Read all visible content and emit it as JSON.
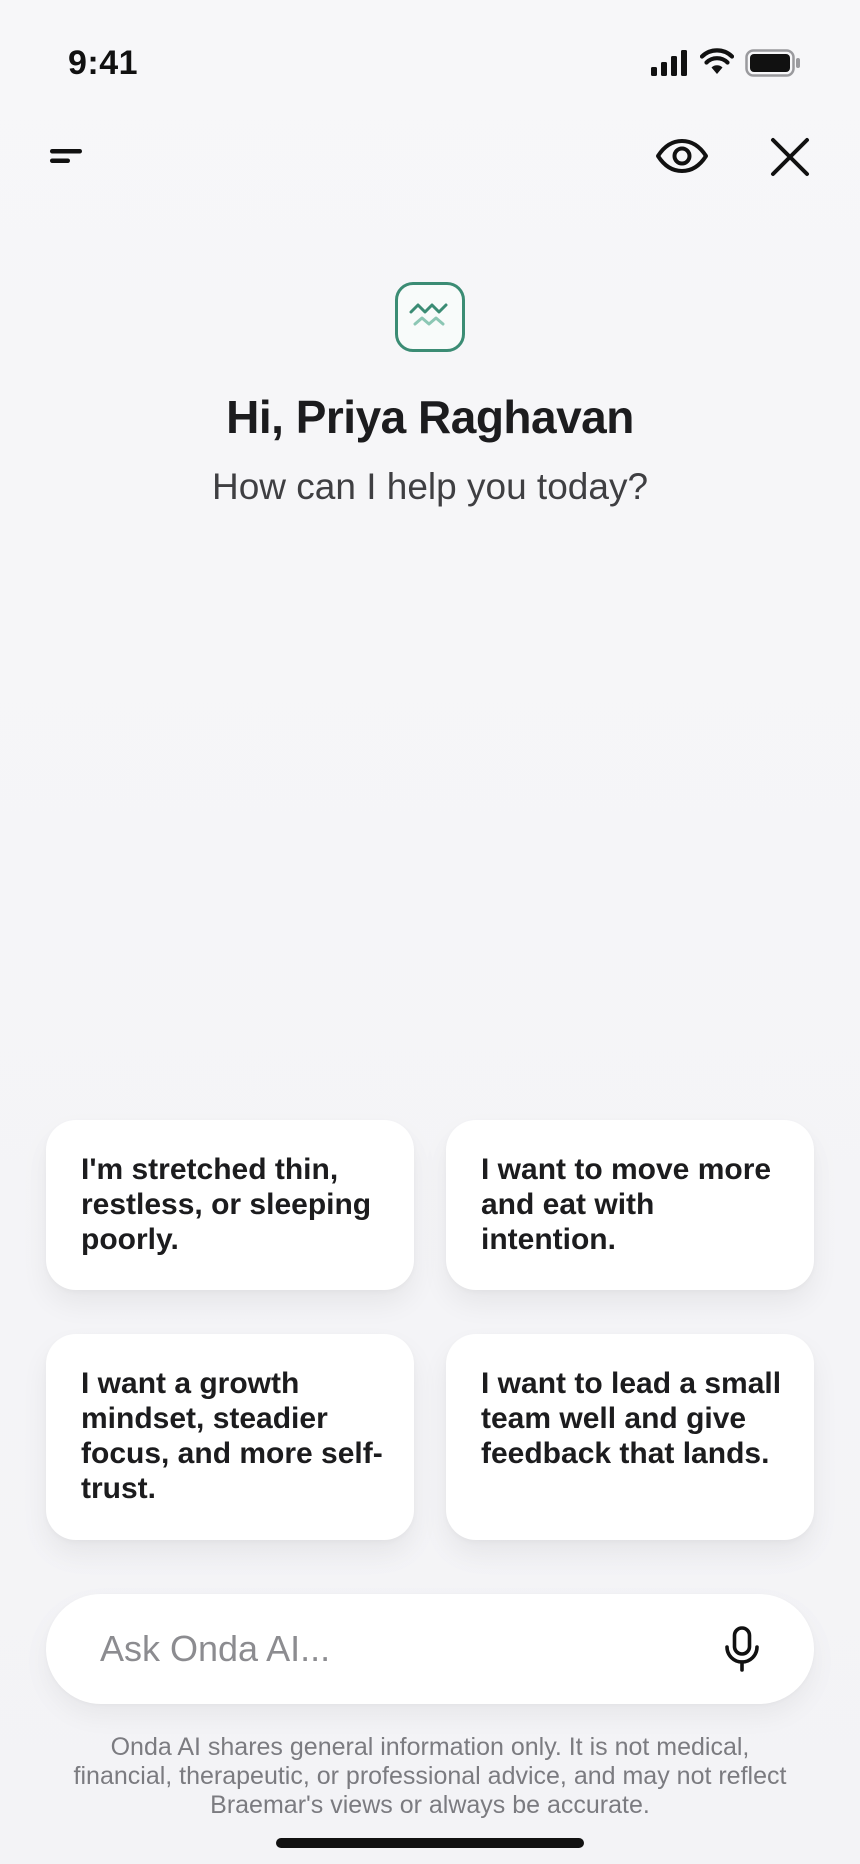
{
  "status_bar": {
    "time": "9:41",
    "icons": [
      "cellular-signal-icon",
      "wifi-icon",
      "battery-icon"
    ]
  },
  "nav": {
    "menu_icon": "menu-icon",
    "privacy_icon": "eye-icon",
    "close_icon": "close-icon"
  },
  "hero": {
    "logo_icon": "wave-logo-icon",
    "greeting": "Hi, Priya Raghavan",
    "subtitle": "How can I help you today?"
  },
  "prompts": [
    {
      "label": "I'm stretched thin, restless, or sleeping poorly."
    },
    {
      "label": "I want to move more and eat with intention."
    },
    {
      "label": "I want a growth mindset, steadier focus, and more self-trust."
    },
    {
      "label": "I want to lead a small team well and give feedback that lands."
    }
  ],
  "input": {
    "placeholder": "Ask Onda AI...",
    "value": "",
    "mic_icon": "microphone-icon"
  },
  "disclaimer": "Onda AI shares general information only. It is not medical, financial, therapeutic, or professional advice, and may not reflect Braemar's views or always be accurate.",
  "colors": {
    "accent": "#3b8c74",
    "accent_light": "#8cc7b4",
    "background": "#f6f6f8",
    "card": "#ffffff",
    "text_primary": "#1c1c1e",
    "text_muted": "#7b7b80"
  }
}
